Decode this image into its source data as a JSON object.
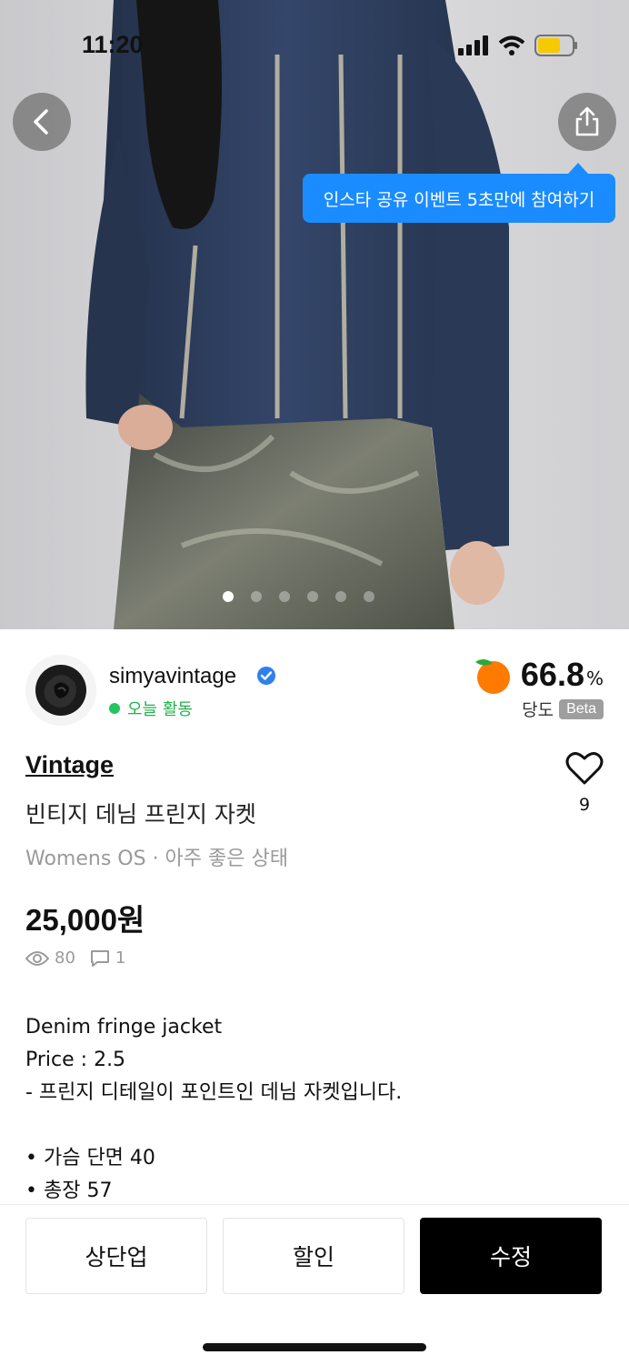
{
  "status_bar": {
    "time": "11:20"
  },
  "photo": {
    "tooltip": "인스타 공유 이벤트 5초만에 참여하기",
    "dots_count": 6,
    "active_dot": 0
  },
  "seller": {
    "name": "simyavintage",
    "activity": "오늘 활동",
    "score_value": "66.8",
    "score_unit": "%",
    "score_label": "당도",
    "score_badge": "Beta"
  },
  "product": {
    "brand": "Vintage",
    "title": "빈티지 데님 프린지 자켓",
    "subtitle": "Womens OS · 아주 좋은 상태",
    "price": "25,000원",
    "likes": "9",
    "views": "80",
    "comments": "1",
    "description": [
      "Denim fringe jacket",
      "Price : 2.5",
      "- 프린지 디테일이 포인트인 데님 자켓입니다.",
      "",
      "• 가슴 단면 40",
      "• 총장 57"
    ]
  },
  "actions": {
    "bump": "상단업",
    "discount": "할인",
    "edit": "수정"
  },
  "colors": {
    "accent": "#1a8cff",
    "active": "#22c55e",
    "dark": "#000000"
  }
}
